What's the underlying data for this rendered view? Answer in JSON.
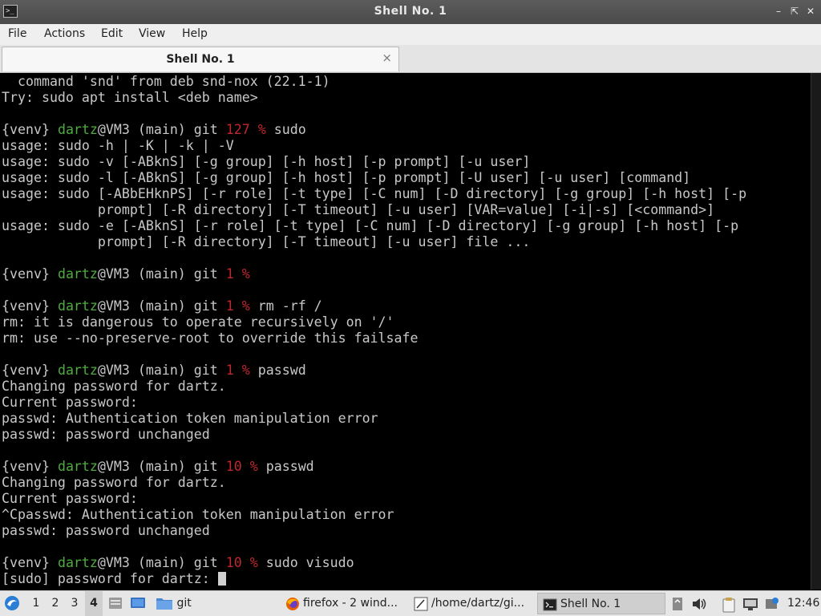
{
  "window": {
    "title": "Shell No. 1",
    "app_icon": "terminal-icon"
  },
  "menu": [
    "File",
    "Actions",
    "Edit",
    "View",
    "Help"
  ],
  "tab": {
    "label": "Shell No. 1",
    "close": "×"
  },
  "terminal": {
    "prompt": {
      "venv": "{venv}",
      "user": "dartz",
      "host_dir": "@VM3 (main) git"
    },
    "lines": [
      {
        "t": "out",
        "text": "  command 'snd' from deb snd-nox (22.1-1)"
      },
      {
        "t": "out",
        "text": "Try: sudo apt install <deb name>"
      },
      {
        "t": "blank"
      },
      {
        "t": "prompt",
        "code": "127",
        "cmd": "sudo"
      },
      {
        "t": "out",
        "text": "usage: sudo -h | -K | -k | -V"
      },
      {
        "t": "out",
        "text": "usage: sudo -v [-ABknS] [-g group] [-h host] [-p prompt] [-u user]"
      },
      {
        "t": "out",
        "text": "usage: sudo -l [-ABknS] [-g group] [-h host] [-p prompt] [-U user] [-u user] [command]"
      },
      {
        "t": "out",
        "text": "usage: sudo [-ABbEHknPS] [-r role] [-t type] [-C num] [-D directory] [-g group] [-h host] [-p"
      },
      {
        "t": "out",
        "text": "            prompt] [-R directory] [-T timeout] [-u user] [VAR=value] [-i|-s] [<command>]"
      },
      {
        "t": "out",
        "text": "usage: sudo -e [-ABknS] [-r role] [-t type] [-C num] [-D directory] [-g group] [-h host] [-p"
      },
      {
        "t": "out",
        "text": "            prompt] [-R directory] [-T timeout] [-u user] file ..."
      },
      {
        "t": "blank"
      },
      {
        "t": "prompt",
        "code": "1",
        "cmd": ""
      },
      {
        "t": "blank"
      },
      {
        "t": "prompt",
        "code": "1",
        "cmd": "rm -rf /"
      },
      {
        "t": "out",
        "text": "rm: it is dangerous to operate recursively on '/'"
      },
      {
        "t": "out",
        "text": "rm: use --no-preserve-root to override this failsafe"
      },
      {
        "t": "blank"
      },
      {
        "t": "prompt",
        "code": "1",
        "cmd": "passwd"
      },
      {
        "t": "out",
        "text": "Changing password for dartz."
      },
      {
        "t": "out",
        "text": "Current password:"
      },
      {
        "t": "out",
        "text": "passwd: Authentication token manipulation error"
      },
      {
        "t": "out",
        "text": "passwd: password unchanged"
      },
      {
        "t": "blank"
      },
      {
        "t": "prompt",
        "code": "10",
        "cmd": "passwd"
      },
      {
        "t": "out",
        "text": "Changing password for dartz."
      },
      {
        "t": "out",
        "text": "Current password:"
      },
      {
        "t": "out",
        "text": "^Cpasswd: Authentication token manipulation error"
      },
      {
        "t": "out",
        "text": "passwd: password unchanged"
      },
      {
        "t": "blank"
      },
      {
        "t": "prompt",
        "code": "10",
        "cmd": "sudo visudo"
      },
      {
        "t": "input",
        "text": "[sudo] password for dartz: "
      }
    ]
  },
  "taskbar": {
    "start_icon": "lxqt-menu-icon",
    "workspaces": [
      "1",
      "2",
      "3",
      "4"
    ],
    "active_workspace": "4",
    "quicklaunch": [
      "file-manager-icon",
      "desktop-icon"
    ],
    "folder_label": "git",
    "tasks": [
      {
        "label": "firefox - 2 wind...",
        "icon": "firefox-icon",
        "active": false
      },
      {
        "label": "/home/dartz/gi...",
        "icon": "text-editor-icon",
        "active": false
      },
      {
        "label": "Shell No. 1",
        "icon": "terminal-icon",
        "active": true
      }
    ],
    "tray": [
      "notification-icon",
      "volume-icon",
      "clipboard-icon",
      "network-icon",
      "update-icon"
    ],
    "clock": "12:46"
  },
  "colors": {
    "prompt_green": "#4eac3e",
    "exit_code_red": "#c0272d",
    "terminal_bg": "#000000",
    "terminal_fg": "#c8c8c8"
  }
}
